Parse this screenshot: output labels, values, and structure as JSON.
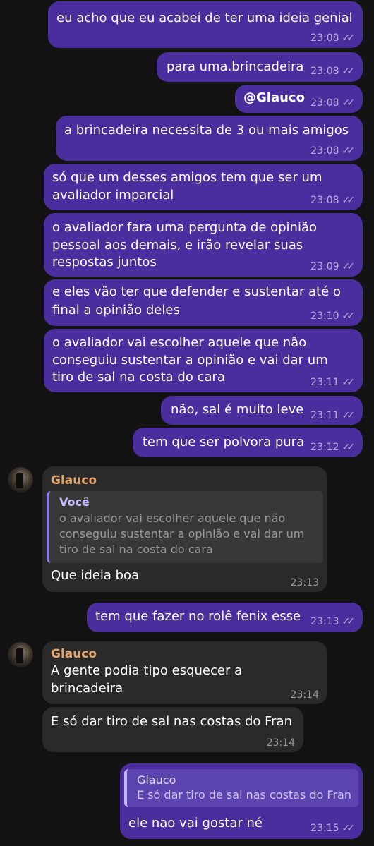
{
  "colors": {
    "outgoing_bubble": "#4b2e9e",
    "incoming_bubble": "#2a2a2a",
    "sender_name": "#e8a56a",
    "background": "#121212"
  },
  "messages": [
    {
      "text": [
        "eu acho que eu acabei de ter uma ideia genial"
      ],
      "time": "23:08",
      "status": "read-icon"
    },
    {
      "text": [
        "para uma.brincadeira"
      ],
      "time": "23:08",
      "status": "read-icon"
    },
    {
      "text": [
        "@Glauco"
      ],
      "time": "23:08",
      "status": "read-icon"
    },
    {
      "text": [
        "a brincadeira necessita de 3 ou mais amigos"
      ],
      "time": "23:08",
      "status": "read-icon"
    },
    {
      "text": [
        "só que um desses amigos tem que ser um",
        "avaliador imparcial"
      ],
      "time": "23:08",
      "status": "read-icon"
    },
    {
      "text": [
        "o avaliador fara uma pergunta de opinião",
        "pessoal aos demais, e irão revelar suas",
        "respostas juntos"
      ],
      "time": "23:09",
      "status": "read-icon"
    },
    {
      "text": [
        "e eles vão ter que defender e sustentar até o",
        "final a opinião deles"
      ],
      "time": "23:10",
      "status": "read-icon"
    },
    {
      "text": [
        "o avaliador vai escolher aquele que não",
        "conseguiu sustentar a opinião e vai dar um",
        "tiro de sal na costa do cara"
      ],
      "time": "23:11",
      "status": "read-icon"
    },
    {
      "text": [
        "não, sal é muito leve"
      ],
      "time": "23:11",
      "status": "read-icon"
    },
    {
      "text": [
        "tem que ser polvora pura"
      ],
      "time": "23:12",
      "status": "read-icon"
    },
    {
      "sender": "Glauco",
      "reply_to": {
        "name": "Você",
        "text": [
          "o avaliador vai escolher aquele que não",
          "conseguiu sustentar a opinião e vai dar um",
          "tiro de sal na costa do cara"
        ]
      },
      "text": [
        "Que ideia boa"
      ],
      "time": "23:13"
    },
    {
      "text": [
        "tem que fazer no rolê fenix esse"
      ],
      "time": "23:13",
      "status": "read-icon"
    },
    {
      "sender": "Glauco",
      "text": [
        "A gente podia tipo esquecer a",
        "brincadeira"
      ],
      "time": "23:14"
    },
    {
      "text": [
        "E só dar tiro de sal nas costas do Fran"
      ],
      "time": "23:14"
    },
    {
      "reply_to": {
        "name": "Glauco",
        "text": [
          "E só dar tiro de sal nas costas do Fran"
        ]
      },
      "text": [
        "ele nao vai gostar né"
      ],
      "time": "23:15",
      "status": "read-icon"
    }
  ]
}
